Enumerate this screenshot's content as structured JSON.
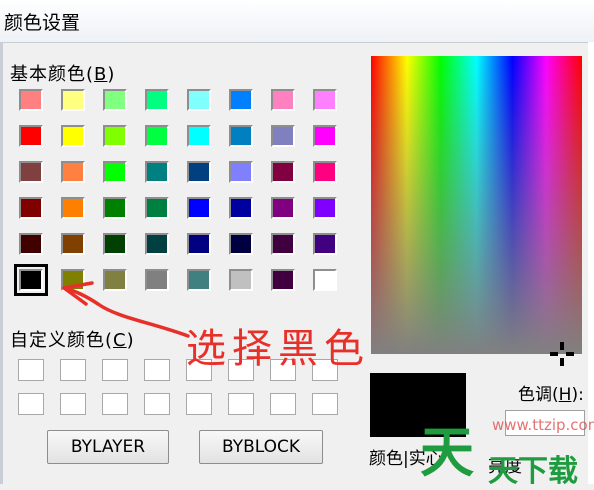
{
  "window": {
    "title": "颜色设置"
  },
  "basic_colors": {
    "label": "基本颜色",
    "mnemonic": "B",
    "swatches": [
      "#ff8080",
      "#ffff80",
      "#80ff80",
      "#00ff80",
      "#80ffff",
      "#0080ff",
      "#ff80c0",
      "#ff80ff",
      "#ff0000",
      "#ffff00",
      "#80ff00",
      "#00ff40",
      "#00ffff",
      "#0080c0",
      "#8080c0",
      "#ff00ff",
      "#804040",
      "#ff8040",
      "#00ff00",
      "#008080",
      "#004080",
      "#8080ff",
      "#800040",
      "#ff0080",
      "#800000",
      "#ff8000",
      "#008000",
      "#008040",
      "#0000ff",
      "#0000a0",
      "#800080",
      "#8000ff",
      "#400000",
      "#804000",
      "#004000",
      "#004040",
      "#000080",
      "#000040",
      "#400040",
      "#400080",
      "#000000",
      "#808000",
      "#808040",
      "#808080",
      "#408080",
      "#c0c0c0",
      "#400040",
      "#ffffff"
    ],
    "selected": "#000000"
  },
  "custom_colors": {
    "label": "自定义颜色",
    "mnemonic": "C",
    "count": 16
  },
  "buttons": {
    "bylayer": "BYLAYER",
    "byblock": "BYBLOCK"
  },
  "preview": {
    "color": "#000000",
    "label": "颜色|实心"
  },
  "hue": {
    "label": "色调",
    "mnemonic": "H"
  },
  "saturation": {
    "label": "亮度"
  },
  "annotation": {
    "text": "选择黑色",
    "color": "#e8302a"
  },
  "watermark": {
    "url": "www.ttzip.com",
    "logo": "天",
    "text": "天下载"
  }
}
